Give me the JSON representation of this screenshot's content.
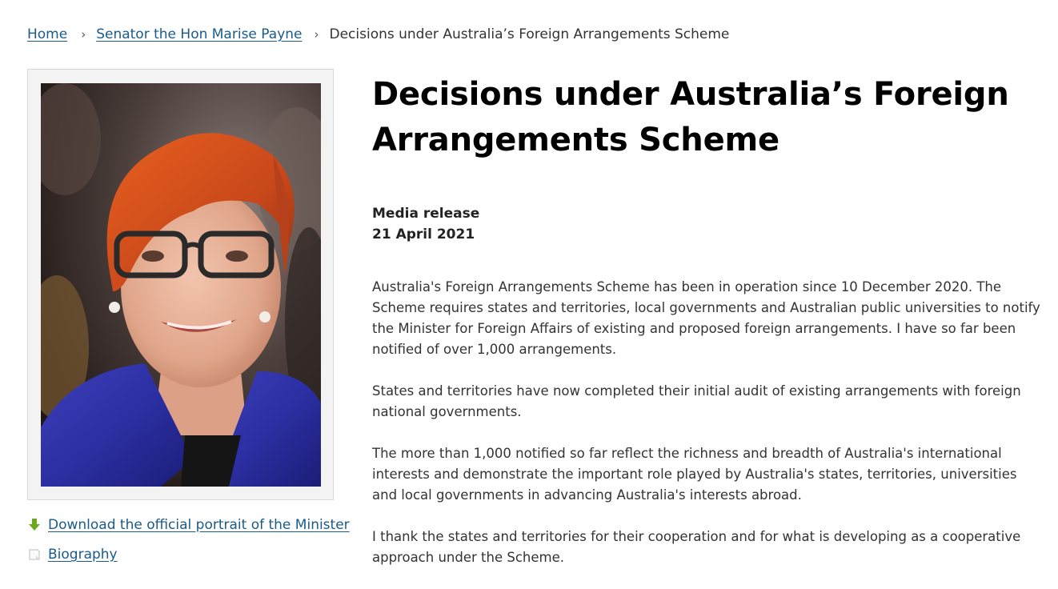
{
  "breadcrumb": {
    "home": "Home",
    "parent": "Senator the Hon Marise Payne",
    "current": "Decisions under Australia’s Foreign Arrangements Scheme",
    "separator": "›"
  },
  "portrait": {
    "alt": "Portrait of Senator the Hon Marise Payne"
  },
  "side_links": {
    "download_label": "Download the official portrait of the Minister",
    "download_icon": "download-arrow-icon",
    "biography_label": "Biography",
    "biography_icon": "document-icon"
  },
  "article": {
    "title": "Decisions under Australia’s Foreign Arrangements Scheme",
    "type": "Media release",
    "date": "21 April 2021",
    "paragraphs": [
      "Australia's Foreign Arrangements Scheme has been in operation since 10 December 2020. The Scheme requires states and territories, local governments and Australian public universities to notify the Minister for Foreign Affairs of existing and proposed foreign arrangements. I have so far been notified of over 1,000 arrangements.",
      "States and territories have now completed their initial audit of existing arrangements with foreign national governments.",
      "The more than 1,000 notified so far reflect the richness and breadth of Australia's international interests and demonstrate the important role played by Australia's states, territories, universities and local governments in advancing Australia's interests abroad.",
      "I thank the states and territories for their cooperation and for what is developing as a cooperative approach under the Scheme."
    ]
  },
  "colors": {
    "link": "#1a5b8a",
    "download_icon": "#6aa81e"
  }
}
